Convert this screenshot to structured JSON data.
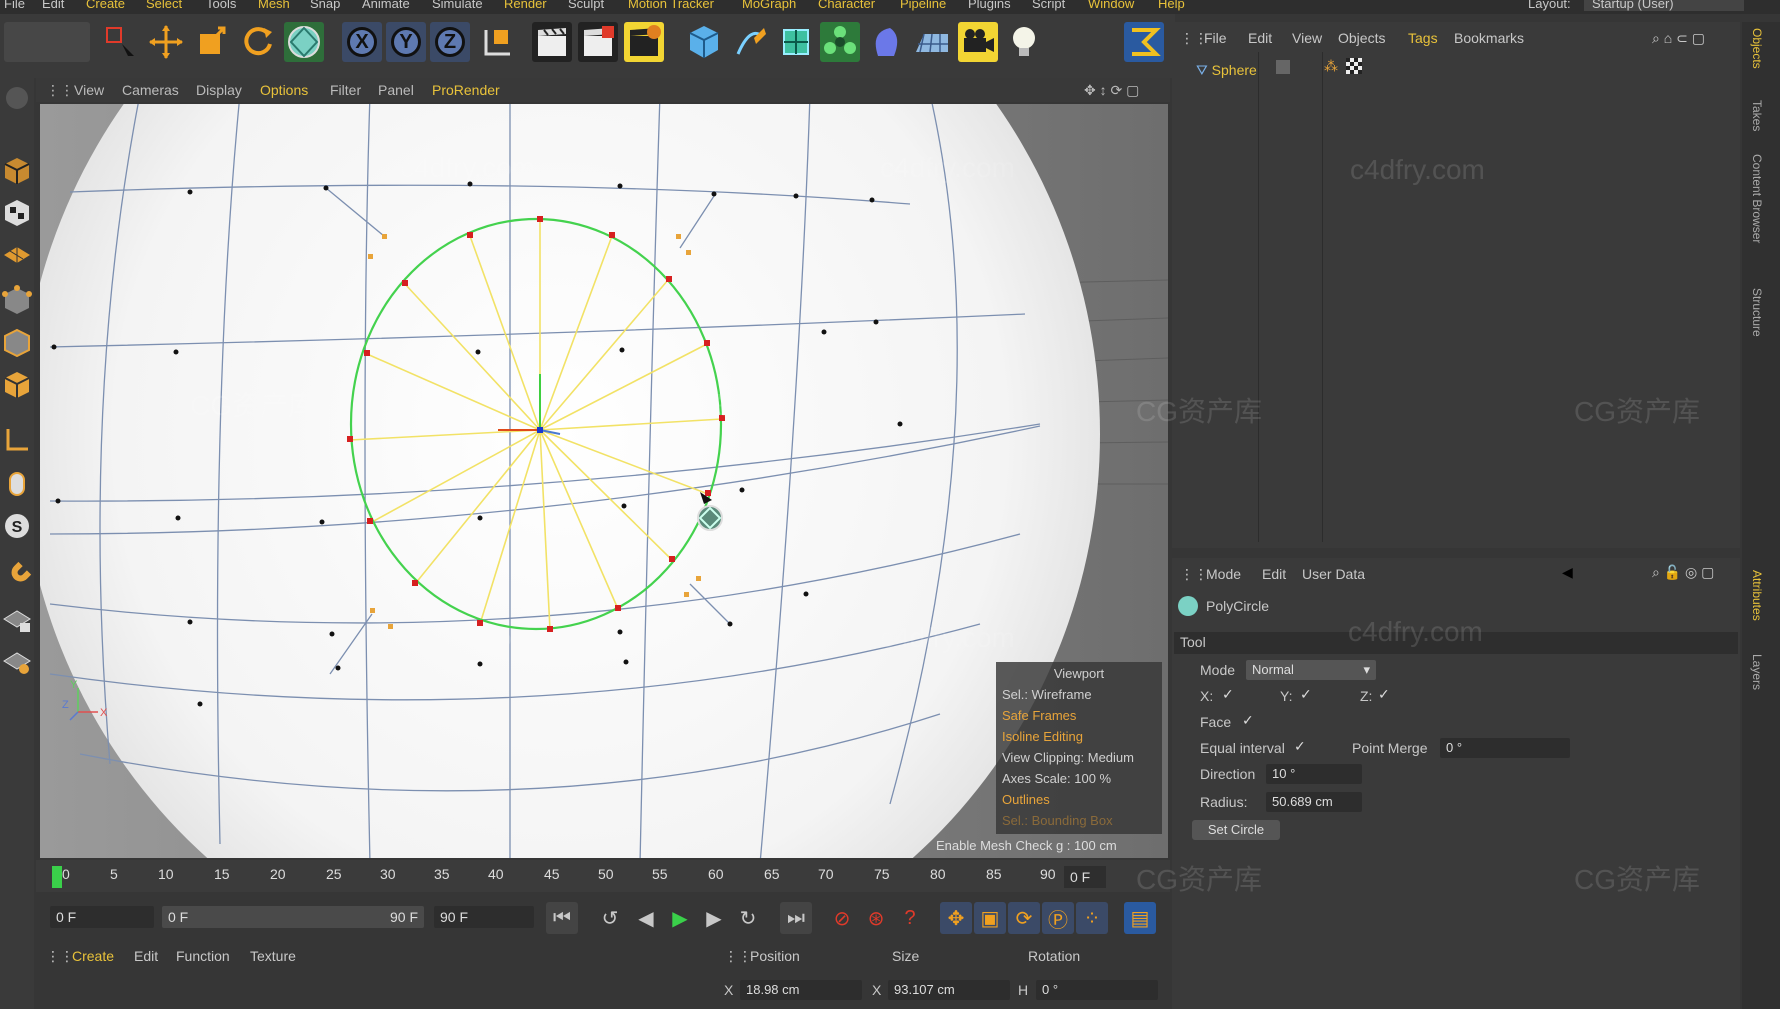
{
  "menu": {
    "items": [
      "File",
      "Edit",
      "Create",
      "Select",
      "Tools",
      "Mesh",
      "Snap",
      "Animate",
      "Simulate",
      "Render",
      "Sculpt",
      "Motion Tracker",
      "MoGraph",
      "Character",
      "Pipeline",
      "Plugins",
      "Script",
      "Window",
      "Help"
    ],
    "layout_label": "Layout:",
    "layout_value": "Startup (User)"
  },
  "viewport": {
    "menu": [
      "View",
      "Cameras",
      "Display",
      "Options",
      "Filter",
      "Panel",
      "ProRender"
    ],
    "hud": {
      "title": "Viewport",
      "rows": [
        "Sel.: Wireframe",
        "Safe Frames",
        "Isoline Editing",
        "View Clipping: Medium",
        "Axes Scale: 100 %",
        "Outlines",
        "Sel.: Bounding Box"
      ]
    },
    "mesh_check": "Enable Mesh Check",
    "grid_spacing": "g : 100 cm"
  },
  "timeline": {
    "ticks": [
      "0",
      "5",
      "10",
      "15",
      "20",
      "25",
      "30",
      "35",
      "40",
      "45",
      "50",
      "55",
      "60",
      "65",
      "70",
      "75",
      "80",
      "85",
      "90"
    ],
    "current": "0 F",
    "start": "0 F",
    "range_start": "0 F",
    "range_end": "90 F",
    "end": "90 F"
  },
  "material_manager": {
    "menu": [
      "Create",
      "Edit",
      "Function",
      "Texture"
    ]
  },
  "coordinates": {
    "headers": [
      "Position",
      "Size",
      "Rotation"
    ],
    "position_label": "X",
    "position_x": "18.98 cm",
    "size_label": "X",
    "size_x": "93.107 cm",
    "rotation_label": "H",
    "rotation_h": "0 °"
  },
  "object_manager": {
    "menu": [
      "File",
      "Edit",
      "View",
      "Objects",
      "Tags",
      "Bookmarks"
    ],
    "object": "Sphere"
  },
  "attributes": {
    "menu": [
      "Mode",
      "Edit",
      "User Data"
    ],
    "tool_name": "PolyCircle",
    "section": "Tool",
    "mode_label": "Mode",
    "mode_value": "Normal",
    "x_label": "X:",
    "y_label": "Y:",
    "z_label": "Z:",
    "face_label": "Face",
    "equal_interval_label": "Equal interval",
    "point_merge_label": "Point Merge",
    "point_merge_value": "0 °",
    "direction_label": "Direction",
    "direction_value": "10 °",
    "radius_label": "Radius:",
    "radius_value": "50.689 cm",
    "set_circle": "Set Circle"
  },
  "right_tabs": [
    "Objects",
    "Takes",
    "Content Browser",
    "Structure",
    "Attributes",
    "Layers"
  ],
  "watermarks": [
    "c4dfry.com",
    "CG资产库"
  ]
}
